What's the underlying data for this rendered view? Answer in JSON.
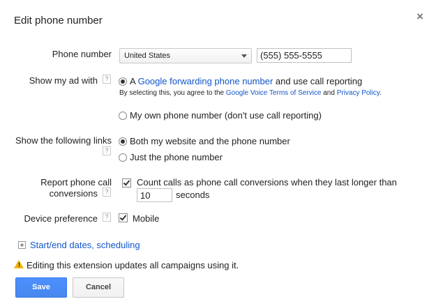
{
  "dialog": {
    "title": "Edit phone number",
    "close_glyph": "×"
  },
  "phone": {
    "label": "Phone number",
    "country": "United States",
    "number": "(555) 555-5555"
  },
  "show_ad": {
    "label": "Show my ad with",
    "help": "?",
    "option_google_prefix": "A",
    "option_google_link": "Google forwarding phone number",
    "option_google_suffix": "and use call reporting",
    "agree_prefix": "By selecting this, you agree to the",
    "agree_tos_link": "Google Voice Terms of Service",
    "agree_and": "and",
    "agree_privacy_link": "Privacy Policy",
    "agree_end": ".",
    "option_own": "My own phone number (don't use call reporting)",
    "selected": "google"
  },
  "links": {
    "label": "Show the following links",
    "help": "?",
    "option_both": "Both my website and the phone number",
    "option_phone": "Just the phone number",
    "selected": "both"
  },
  "report": {
    "label_line1": "Report phone call",
    "label_line2": "conversions",
    "help": "?",
    "checkbox_label": "Count calls as phone call conversions when they last longer than",
    "seconds_value": "10",
    "seconds_unit": "seconds",
    "checked": true
  },
  "device": {
    "label": "Device preference",
    "help": "?",
    "checkbox_label": "Mobile",
    "checked": true
  },
  "scheduling": {
    "link": "Start/end dates, scheduling"
  },
  "warning": {
    "icon": "warning-icon",
    "mark": "!",
    "text": "Editing this extension updates all campaigns using it."
  },
  "actions": {
    "save_label": "Save",
    "cancel_label": "Cancel"
  },
  "colors": {
    "link": "#1155cc",
    "primary_button": "#4d90fe",
    "warning": "#f0b400"
  }
}
